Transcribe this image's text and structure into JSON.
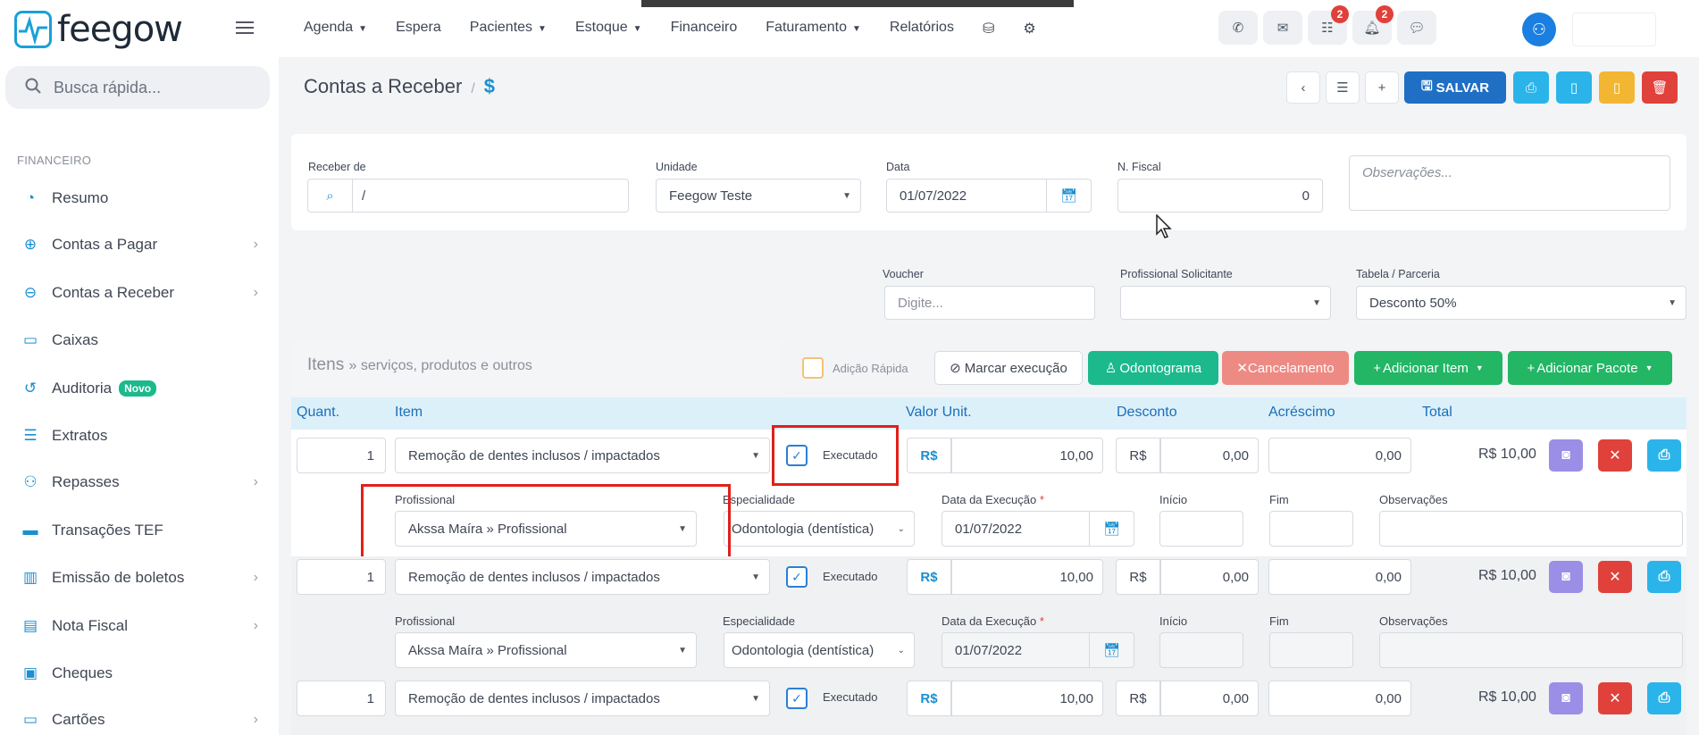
{
  "brand": {
    "name": "feegow"
  },
  "search": {
    "placeholder": "Busca rápida..."
  },
  "sidebar": {
    "section": "FINANCEIRO",
    "items": [
      {
        "label": "Resumo",
        "icon": "palette-icon"
      },
      {
        "label": "Contas a Pagar",
        "icon": "arrow-up-circle-icon",
        "chevron": true
      },
      {
        "label": "Contas a Receber",
        "icon": "arrow-down-circle-icon",
        "chevron": true
      },
      {
        "label": "Caixas",
        "icon": "inbox-icon"
      },
      {
        "label": "Auditoria",
        "icon": "history-icon",
        "badge": "Novo"
      },
      {
        "label": "Extratos",
        "icon": "list-icon"
      },
      {
        "label": "Repasses",
        "icon": "users-icon",
        "chevron": true
      },
      {
        "label": "Transações TEF",
        "icon": "card-icon"
      },
      {
        "label": "Emissão de boletos",
        "icon": "barcode-icon",
        "chevron": true
      },
      {
        "label": "Nota Fiscal",
        "icon": "file-icon",
        "chevron": true
      },
      {
        "label": "Cheques",
        "icon": "cheque-icon"
      },
      {
        "label": "Cartões",
        "icon": "credit-card-icon",
        "chevron": true
      }
    ]
  },
  "topnav": [
    {
      "label": "Agenda",
      "caret": true
    },
    {
      "label": "Espera"
    },
    {
      "label": "Pacientes",
      "caret": true
    },
    {
      "label": "Estoque",
      "caret": true
    },
    {
      "label": "Financeiro"
    },
    {
      "label": "Faturamento",
      "caret": true
    },
    {
      "label": "Relatórios"
    }
  ],
  "notifications": {
    "tasks": "2",
    "bell": "2"
  },
  "header": {
    "title": "Contas a Receber",
    "separator": "/",
    "symbol": "$",
    "save": "SALVAR"
  },
  "form": {
    "receber_de": {
      "label": "Receber de",
      "value": "/"
    },
    "unidade": {
      "label": "Unidade",
      "value": "Feegow Teste"
    },
    "data": {
      "label": "Data",
      "value": "01/07/2022"
    },
    "nfiscal": {
      "label": "N. Fiscal",
      "value": "0"
    },
    "observacoes": {
      "placeholder": "Observações..."
    },
    "voucher": {
      "label": "Voucher",
      "placeholder": "Digite..."
    },
    "profissional_solicitante": {
      "label": "Profissional Solicitante",
      "value": ""
    },
    "tabela": {
      "label": "Tabela / Parceria",
      "value": "Desconto 50%"
    }
  },
  "items": {
    "title": "Itens",
    "subtitle": "» serviços, produtos e outros",
    "quick_add": "Adição Rápida",
    "marcar": "Marcar execução",
    "odontograma": "Odontograma",
    "cancelamento": "Cancelamento",
    "add_item": "Adicionar Item",
    "add_pacote": "Adicionar Pacote",
    "columns": {
      "quant": "Quant.",
      "item": "Item",
      "valor": "Valor Unit.",
      "desconto": "Desconto",
      "acrescimo": "Acréscimo",
      "total": "Total"
    },
    "sub_columns": {
      "profissional": "Profissional",
      "especialidade": "Especialidade",
      "data_exec": "Data da Execução",
      "inicio": "Início",
      "fim": "Fim",
      "obs": "Observações"
    },
    "currency": "R$",
    "rows": [
      {
        "quant": "1",
        "item": "Remoção de dentes inclusos / impactados",
        "status": "Executado",
        "valor": "10,00",
        "desconto": "0,00",
        "acrescimo": "0,00",
        "total": "R$ 10,00",
        "profissional": "Akssa Maíra » Profissional",
        "especialidade": "Odontologia (dentística)",
        "data_exec": "01/07/2022"
      },
      {
        "quant": "1",
        "item": "Remoção de dentes inclusos / impactados",
        "status": "Executado",
        "valor": "10,00",
        "desconto": "0,00",
        "acrescimo": "0,00",
        "total": "R$ 10,00",
        "profissional": "Akssa Maíra » Profissional",
        "especialidade": "Odontologia (dentística)",
        "data_exec": "01/07/2022"
      },
      {
        "quant": "1",
        "item": "Remoção de dentes inclusos / impactados",
        "status": "Executado",
        "valor": "10,00",
        "desconto": "0,00",
        "acrescimo": "0,00",
        "total": "R$ 10,00"
      }
    ]
  },
  "colors": {
    "primary": "#1a8fd1",
    "save": "#1f6fc4",
    "teal": "#1cb98c",
    "green": "#22b665",
    "salmon": "#ee8a84",
    "purple": "#9a8ee6",
    "red": "#e0413b",
    "cyan": "#2bb4ea",
    "yellow": "#f3b632"
  }
}
